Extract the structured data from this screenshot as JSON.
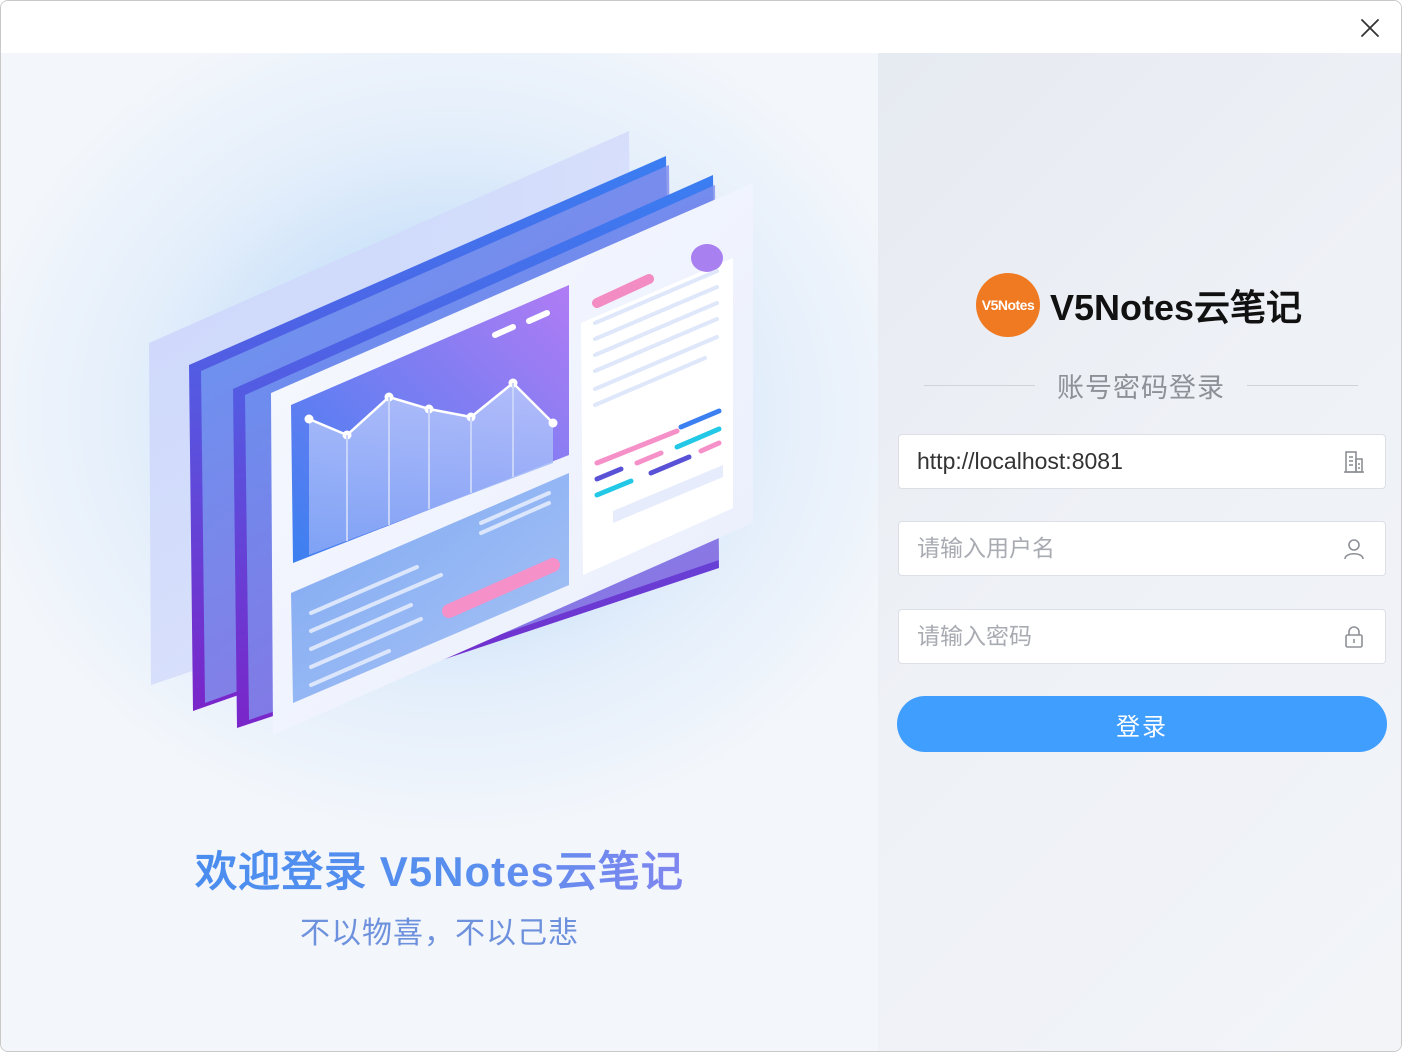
{
  "window": {
    "close_icon": "close-icon"
  },
  "left": {
    "welcome_title": "欢迎登录 V5Notes云笔记",
    "welcome_subtitle": "不以物喜，不以己悲",
    "illustration": "dashboard-screens-illustration"
  },
  "brand": {
    "logo_text": "V5Notes",
    "name": "V5Notes云笔记",
    "logo_color": "#f07a22"
  },
  "login": {
    "mode_label": "账号密码登录",
    "server": {
      "value": "http://localhost:8081",
      "placeholder": "",
      "icon": "building-icon"
    },
    "username": {
      "value": "",
      "placeholder": "请输入用户名",
      "icon": "user-icon"
    },
    "password": {
      "value": "",
      "placeholder": "请输入密码",
      "icon": "lock-icon"
    },
    "submit_label": "登录",
    "accent": "#409eff"
  }
}
